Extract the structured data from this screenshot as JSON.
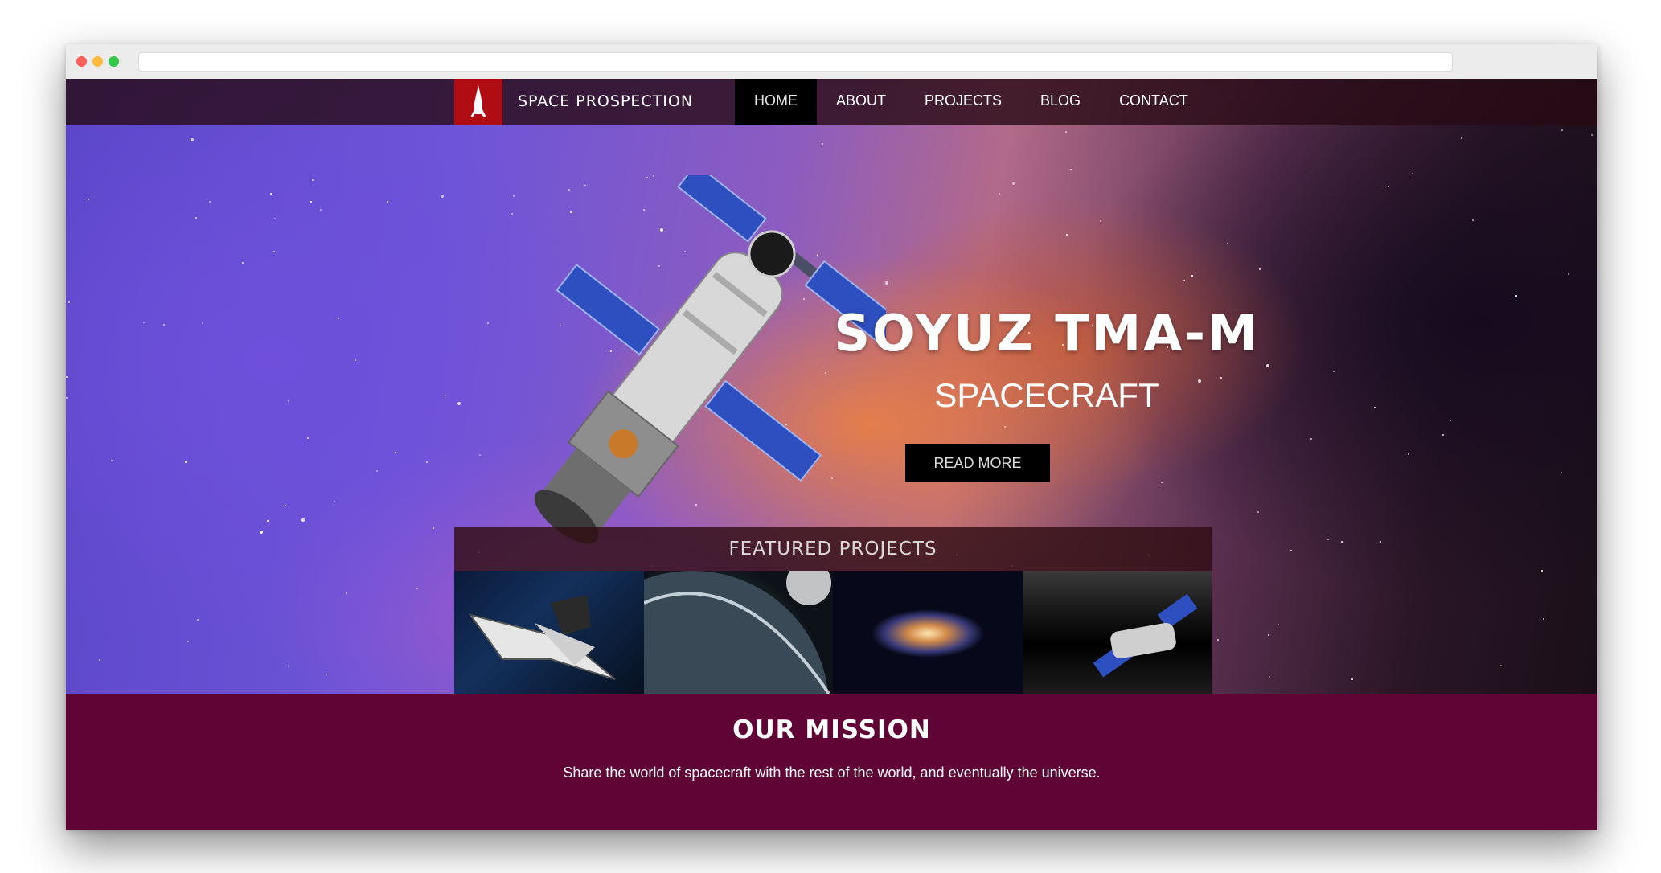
{
  "nav": {
    "brand": "SPACE PROSPECTION",
    "items": [
      {
        "label": "HOME",
        "active": true
      },
      {
        "label": "ABOUT",
        "active": false
      },
      {
        "label": "PROJECTS",
        "active": false
      },
      {
        "label": "BLOG",
        "active": false
      },
      {
        "label": "CONTACT",
        "active": false
      }
    ]
  },
  "hero": {
    "title": "SOYUZ TMA-M",
    "subtitle": "SPACECRAFT",
    "button": "READ MORE"
  },
  "featured": {
    "title": "FEATURED PROJECTS",
    "thumbnails": [
      "space-shuttle",
      "planet-earth",
      "spiral-galaxy",
      "satellite-over-moon"
    ]
  },
  "mission": {
    "title": "OUR MISSION",
    "text": "Share the world of spacecraft with the rest of the world, and eventually the universe."
  },
  "colors": {
    "nav_active": "#000000",
    "logo_red": "#b00c14",
    "mission_bg": "#600435",
    "button_bg": "#000000"
  }
}
